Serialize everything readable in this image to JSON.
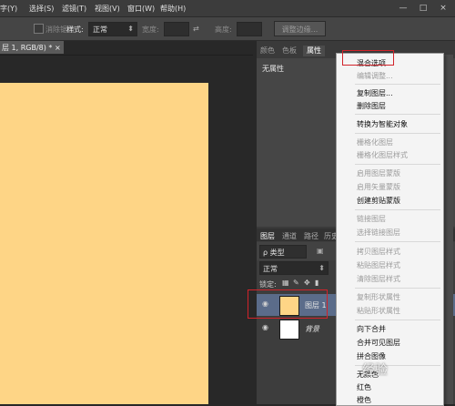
{
  "menubar": {
    "items": [
      "字(Y)",
      "选择(S)",
      "滤镜(T)",
      "视图(V)",
      "窗口(W)",
      "帮助(H)"
    ],
    "window_controls": [
      "—",
      "□",
      "×"
    ]
  },
  "options": {
    "cb_label": "消除锯齿",
    "style_label": "样式:",
    "style_value": "正常",
    "width_label": "宽度:",
    "height_label": "高度:",
    "refine_label": "调整边缘..."
  },
  "document": {
    "tab_title": "层 1, RGB/8) * ×",
    "fill_color": "#fed586"
  },
  "panel": {
    "tabs": [
      "颜色",
      "色板",
      "属性"
    ],
    "no_props": "无属性"
  },
  "layers_panel": {
    "tabs": [
      "图层",
      "通道",
      "路径",
      "历史"
    ],
    "filter_label": "ρ 类型",
    "blend_mode": "正常",
    "lock_label": "锁定:",
    "layers": [
      {
        "name": "图层 1",
        "color": "#fed586"
      },
      {
        "name": "背景",
        "color": "#ffffff"
      }
    ]
  },
  "context_menu": {
    "items": [
      {
        "label": "混合选项...",
        "enabled": true
      },
      {
        "label": "编辑调整...",
        "enabled": false
      },
      {
        "label": "复制图层...",
        "enabled": true
      },
      {
        "label": "删除图层",
        "enabled": true
      },
      {
        "label": "转换为智能对象",
        "enabled": true
      },
      {
        "label": "栅格化图层",
        "enabled": false
      },
      {
        "label": "栅格化图层样式",
        "enabled": false
      },
      {
        "label": "启用图层蒙版",
        "enabled": false
      },
      {
        "label": "启用矢量蒙版",
        "enabled": false
      },
      {
        "label": "创建剪贴蒙版",
        "enabled": true
      },
      {
        "label": "链接图层",
        "enabled": false
      },
      {
        "label": "选择链接图层",
        "enabled": false
      },
      {
        "label": "拷贝图层样式",
        "enabled": false
      },
      {
        "label": "粘贴图层样式",
        "enabled": false
      },
      {
        "label": "清除图层样式",
        "enabled": false
      },
      {
        "label": "复制形状属性",
        "enabled": false
      },
      {
        "label": "粘贴形状属性",
        "enabled": false
      },
      {
        "label": "向下合并",
        "enabled": true
      },
      {
        "label": "合并可见图层",
        "enabled": true
      },
      {
        "label": "拼合图像",
        "enabled": true
      },
      {
        "label": "无颜色",
        "enabled": true
      },
      {
        "label": "红色",
        "enabled": true
      },
      {
        "label": "橙色",
        "enabled": true
      }
    ]
  },
  "watermark": "经验",
  "colors": {
    "highlight": "#d2232a",
    "doc": "#fed586"
  }
}
